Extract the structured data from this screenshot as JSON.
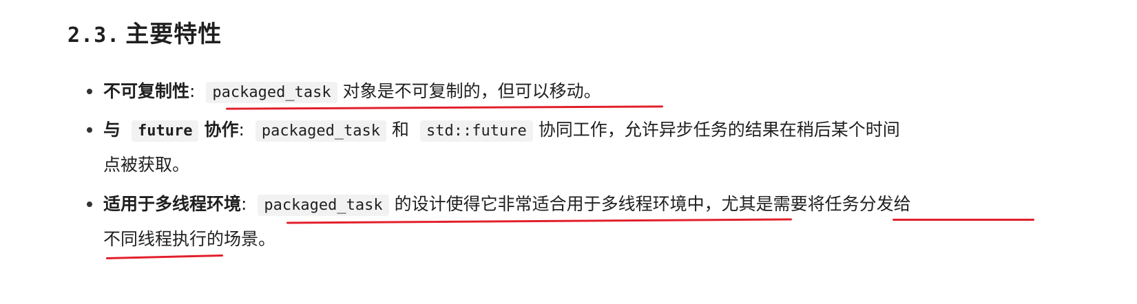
{
  "section": {
    "number": "2.3.",
    "title": "主要特性"
  },
  "items": [
    {
      "bold": "不可复制性",
      "colon": ":",
      "code1": "packaged_task",
      "text": "对象是不可复制的，但可以移动。"
    },
    {
      "bold_a": "与",
      "code_a": "future",
      "bold_b": "协作",
      "colon": ":",
      "code1": "packaged_task",
      "and": "和",
      "code2": "std::future",
      "text": "协同工作，允许异步任务的结果在稍后某个时间",
      "text_cont": "点被获取。"
    },
    {
      "bold": "适用于多线程环境",
      "colon": ":",
      "code1": "packaged_task",
      "text": "的设计使得它非常适合用于多线程环境中，尤其是需要将任务分发给",
      "text_cont": "不同线程执行的场景。"
    }
  ],
  "colors": {
    "underline": "#e21f2a",
    "code_bg": "#f2f2f2"
  }
}
